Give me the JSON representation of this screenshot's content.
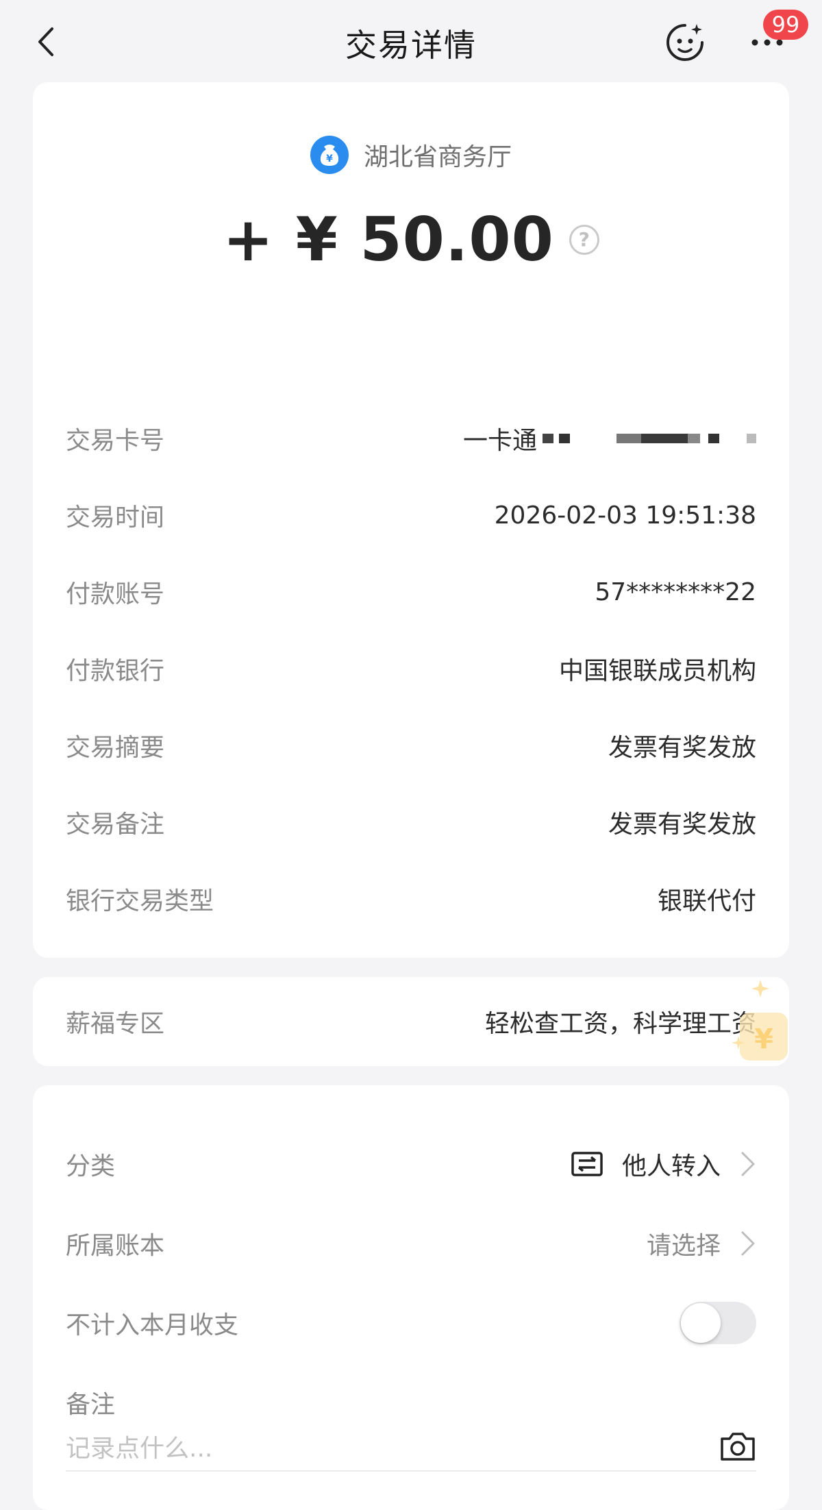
{
  "header": {
    "title": "交易详情",
    "badge_count": "99"
  },
  "transaction": {
    "payer_name": "湖北省商务厅",
    "payer_logo_symbol": "¥",
    "amount": "+ ¥ 50.00",
    "help_symbol": "?",
    "details": [
      {
        "label": "交易卡号",
        "value": "一卡通"
      },
      {
        "label": "交易时间",
        "value": "2026-02-03 19:51:38"
      },
      {
        "label": "付款账号",
        "value": "57********22"
      },
      {
        "label": "付款银行",
        "value": "中国银联成员机构"
      },
      {
        "label": "交易摘要",
        "value": "发票有奖发放"
      },
      {
        "label": "交易备注",
        "value": "发票有奖发放"
      },
      {
        "label": "银行交易类型",
        "value": "银联代付"
      }
    ]
  },
  "salary": {
    "label": "薪福专区",
    "value": "轻松查工资，科学理工资"
  },
  "settings": {
    "category_label": "分类",
    "category_value": "他人转入",
    "ledger_label": "所属账本",
    "ledger_value": "请选择",
    "exclude_label": "不计入本月收支",
    "exclude_on": false,
    "note_label": "备注",
    "note_placeholder": "记录点什么..."
  },
  "colors": {
    "background": "#f4f4f6",
    "badge": "#f0454a",
    "payer_logo": "#2b8cef"
  },
  "icons": [
    "back-icon",
    "assistant-icon",
    "more-icon",
    "help-icon",
    "category-icon",
    "chevron-right-icon",
    "camera-icon"
  ]
}
